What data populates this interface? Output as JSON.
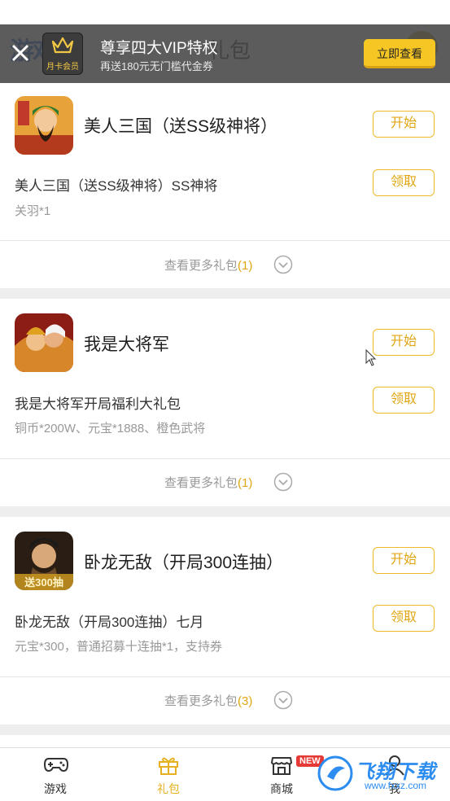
{
  "header": {
    "logo_text": "游戏",
    "title": "礼包"
  },
  "vip": {
    "badge": "月卡会员",
    "title": "尊享四大VIP特权",
    "subtitle": "再送180元无门槛代金券",
    "button": "立即查看"
  },
  "cards": [
    {
      "name": "美人三国（送SS级神将）",
      "start_label": "开始",
      "gift_title": "美人三国（送SS级神将）SS神将",
      "gift_desc": "关羽*1",
      "claim_label": "领取",
      "more_label": "查看更多礼包",
      "more_count": "(1)"
    },
    {
      "name": "我是大将军",
      "start_label": "开始",
      "gift_title": "我是大将军开局福利大礼包",
      "gift_desc": "铜币*200W、元宝*1888、橙色武将",
      "claim_label": "领取",
      "more_label": "查看更多礼包",
      "more_count": "(1)"
    },
    {
      "name": "卧龙无敌（开局300连抽）",
      "start_label": "开始",
      "gift_title": "卧龙无敌（开局300连抽）七月",
      "gift_desc": "元宝*300，普通招募十连抽*1，支持券",
      "claim_label": "领取",
      "more_label": "查看更多礼包",
      "more_count": "(3)",
      "icon_caption": "送300抽"
    }
  ],
  "tabs": [
    {
      "label": "游戏",
      "icon": "gamepad-icon"
    },
    {
      "label": "礼包",
      "icon": "gift-icon",
      "active": true
    },
    {
      "label": "商城",
      "icon": "store-icon",
      "badge": "NEW"
    },
    {
      "label": "我",
      "icon": "user-icon"
    }
  ],
  "watermark": {
    "text": "飞翔下载",
    "sub": "www.fxxz.com"
  },
  "colors": {
    "accent": "#f0b92b",
    "accent_text": "#e0a612",
    "vip_button": "#f5c624"
  }
}
